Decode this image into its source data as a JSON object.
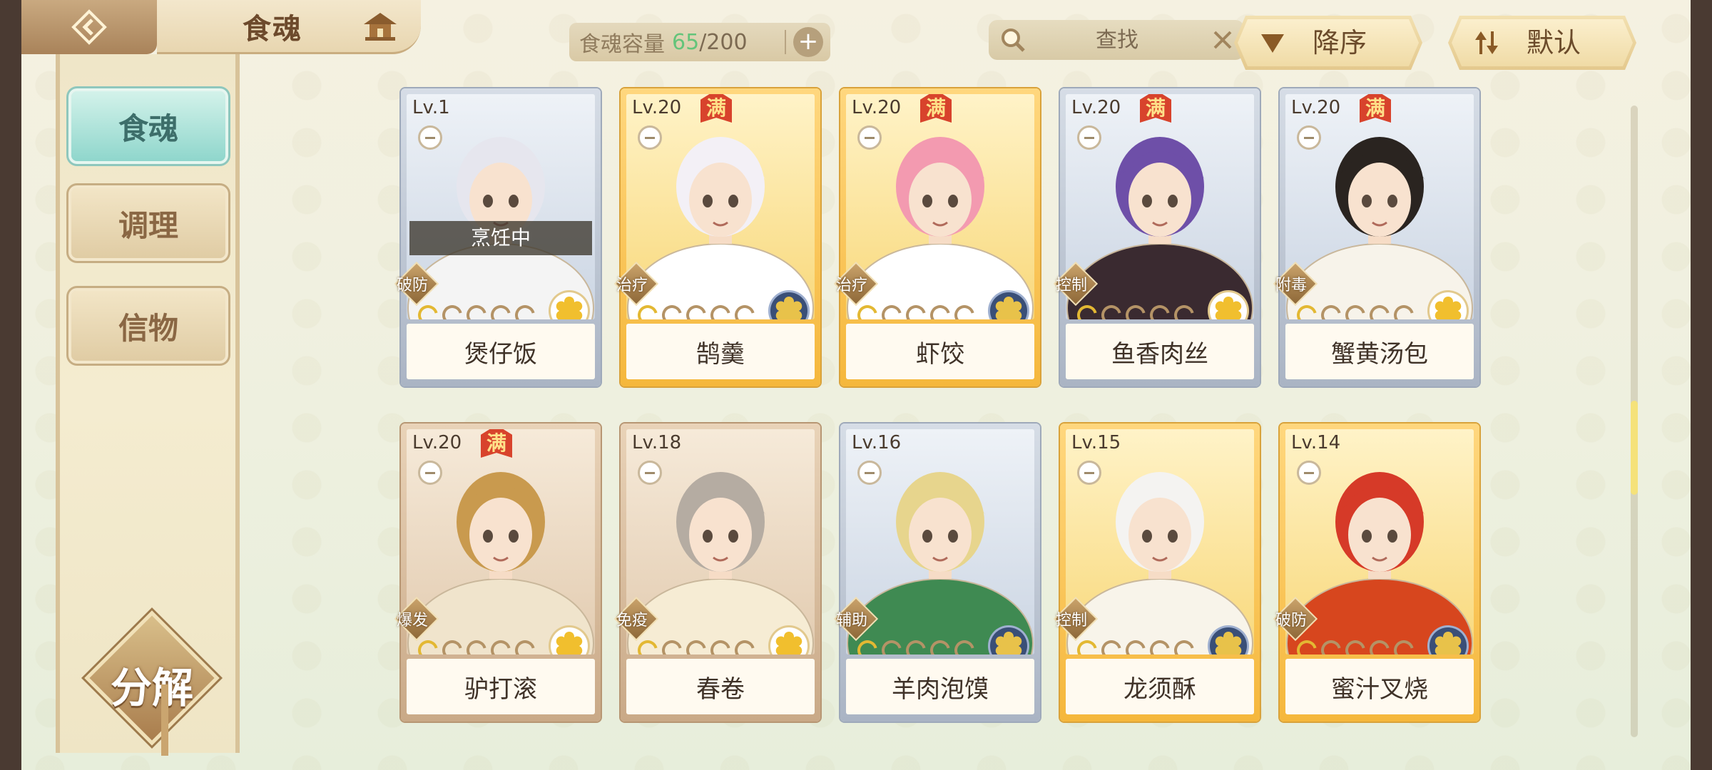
{
  "header": {
    "title": "食魂",
    "capacity_label": "食魂容量",
    "capacity_current": "65",
    "capacity_max": "/200",
    "plus_label": "+",
    "search_placeholder": "查找",
    "sort_desc_label": "降序",
    "sort_default_label": "默认"
  },
  "sidebar": {
    "items": [
      {
        "label": "食魂",
        "active": true
      },
      {
        "label": "调理",
        "active": false
      },
      {
        "label": "信物",
        "active": false
      }
    ],
    "decompose_label": "分解"
  },
  "cards": [
    {
      "level": "Lv.1",
      "name": "煲仔饭",
      "role": "破防",
      "stars": 1,
      "full": false,
      "status": "烹饪中",
      "frame": "silver",
      "flower": "light"
    },
    {
      "level": "Lv.20",
      "name": "鹄羹",
      "role": "治疗",
      "stars": 1,
      "full": true,
      "status": "",
      "frame": "gold",
      "flower": "dark"
    },
    {
      "level": "Lv.20",
      "name": "虾饺",
      "role": "治疗",
      "stars": 1,
      "full": true,
      "status": "",
      "frame": "gold",
      "flower": "dark"
    },
    {
      "level": "Lv.20",
      "name": "鱼香肉丝",
      "role": "控制",
      "stars": 1,
      "full": true,
      "status": "",
      "frame": "silver",
      "flower": "light"
    },
    {
      "level": "Lv.20",
      "name": "蟹黄汤包",
      "role": "附毒",
      "stars": 1,
      "full": true,
      "status": "",
      "frame": "silver",
      "flower": "light"
    },
    {
      "level": "Lv.20",
      "name": "驴打滚",
      "role": "爆发",
      "stars": 1,
      "full": true,
      "status": "",
      "frame": "bronze",
      "flower": "light"
    },
    {
      "level": "Lv.18",
      "name": "春卷",
      "role": "免疫",
      "stars": 1,
      "full": false,
      "status": "",
      "frame": "bronze",
      "flower": "light"
    },
    {
      "level": "Lv.16",
      "name": "羊肉泡馍",
      "role": "辅助",
      "stars": 1,
      "full": false,
      "status": "",
      "frame": "silver",
      "flower": "dark"
    },
    {
      "level": "Lv.15",
      "name": "龙须酥",
      "role": "控制",
      "stars": 1,
      "full": false,
      "status": "",
      "frame": "gold",
      "flower": "dark"
    },
    {
      "level": "Lv.14",
      "name": "蜜汁叉烧",
      "role": "破防",
      "stars": 1,
      "full": false,
      "status": "",
      "frame": "gold",
      "flower": "dark"
    }
  ],
  "full_badge": "满",
  "colors": {
    "active_tab": "#8fd6cc",
    "capacity_highlight": "#64c47a",
    "badge_red": "#d8432c"
  }
}
